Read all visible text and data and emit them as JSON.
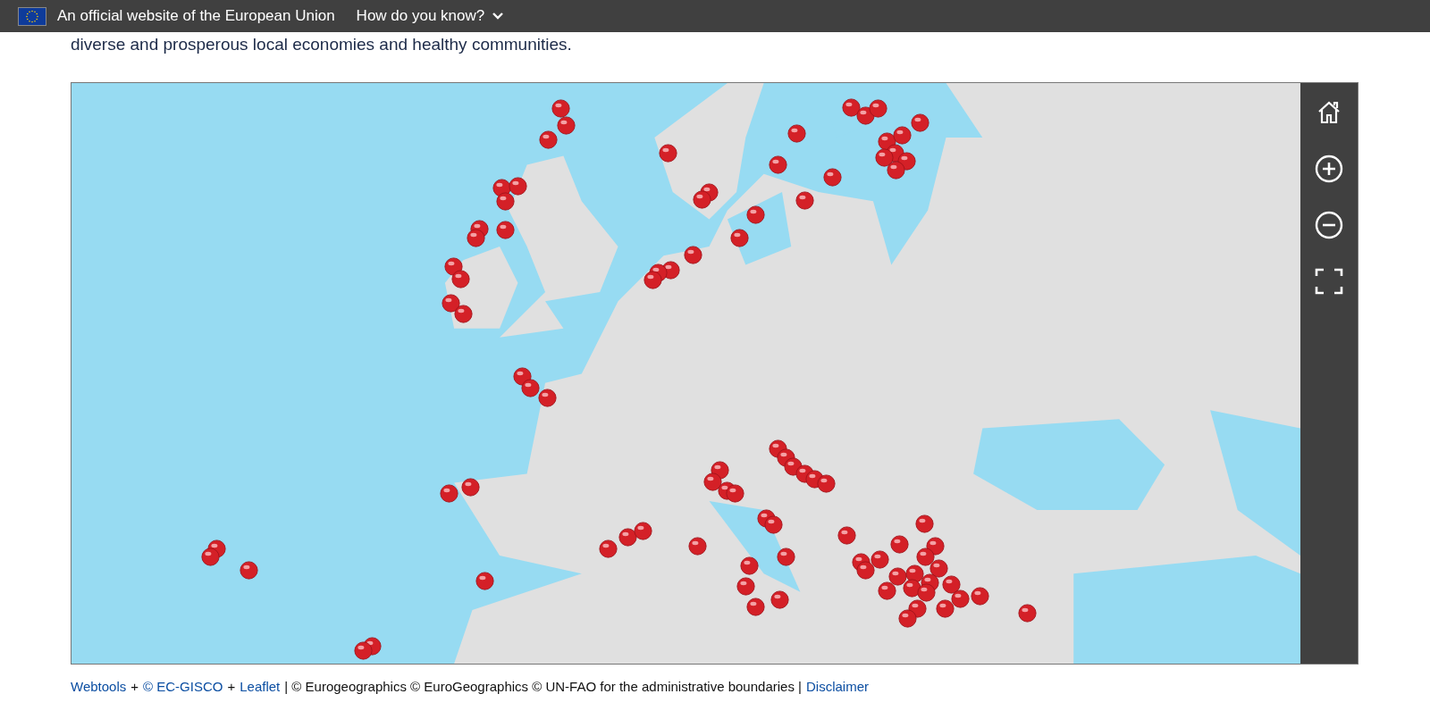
{
  "eu_banner": {
    "text": "An official website of the European Union",
    "toggle": "How do you know?"
  },
  "intro": "diverse and prosperous local economies and healthy communities.",
  "map": {
    "kind": "picture",
    "controls": [
      {
        "kind": "home"
      },
      {
        "kind": "zoom_in"
      },
      {
        "kind": "zoom_out"
      },
      {
        "kind": "fullscreen"
      }
    ]
  },
  "attribution": [
    {
      "kind": "link",
      "text": "Webtools"
    },
    {
      "kind": "text",
      "text": "+"
    },
    {
      "kind": "link",
      "text": "© EC-GISCO"
    },
    {
      "kind": "text",
      "text": "+"
    },
    {
      "kind": "link",
      "text": "Leaflet"
    },
    {
      "kind": "text",
      "text": "| © Eurogeographics © EuroGeographics © UN-FAO for the administrative boundaries |"
    },
    {
      "kind": "link",
      "text": "Disclaimer"
    }
  ]
}
